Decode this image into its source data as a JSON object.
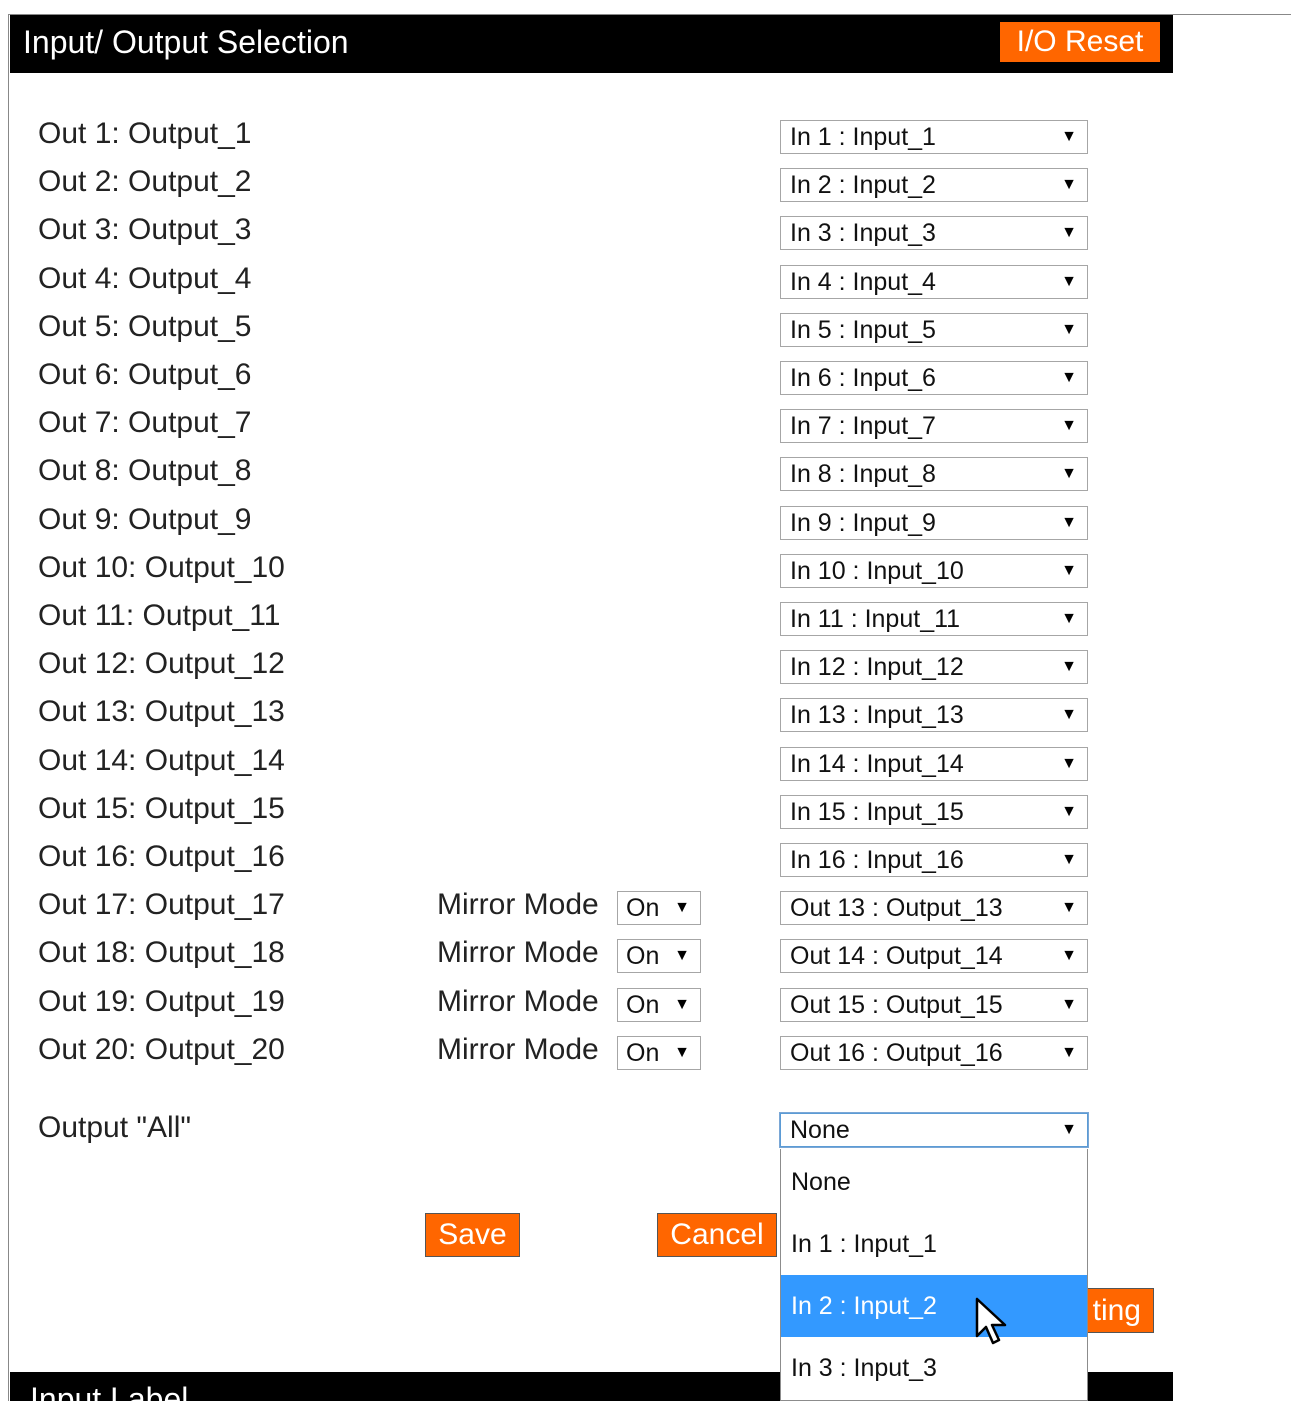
{
  "panel": {
    "title": "Input/ Output Selection",
    "reset_label": "I/O Reset"
  },
  "outputs": [
    {
      "label": "Out 1: Output_1",
      "selection": "In 1 : Input_1"
    },
    {
      "label": "Out 2: Output_2",
      "selection": "In 2 : Input_2"
    },
    {
      "label": "Out 3: Output_3",
      "selection": "In 3 : Input_3"
    },
    {
      "label": "Out 4: Output_4",
      "selection": "In 4 : Input_4"
    },
    {
      "label": "Out 5: Output_5",
      "selection": "In 5 : Input_5"
    },
    {
      "label": "Out 6: Output_6",
      "selection": "In 6 : Input_6"
    },
    {
      "label": "Out 7: Output_7",
      "selection": "In 7 : Input_7"
    },
    {
      "label": "Out 8: Output_8",
      "selection": "In 8 : Input_8"
    },
    {
      "label": "Out 9: Output_9",
      "selection": "In 9 : Input_9"
    },
    {
      "label": "Out 10: Output_10",
      "selection": "In 10 : Input_10"
    },
    {
      "label": "Out 11: Output_11",
      "selection": "In 11 : Input_11"
    },
    {
      "label": "Out 12: Output_12",
      "selection": "In 12 : Input_12"
    },
    {
      "label": "Out 13: Output_13",
      "selection": "In 13 : Input_13"
    },
    {
      "label": "Out 14: Output_14",
      "selection": "In 14 : Input_14"
    },
    {
      "label": "Out 15: Output_15",
      "selection": "In 15 : Input_15"
    },
    {
      "label": "Out 16: Output_16",
      "selection": "In 16 : Input_16"
    },
    {
      "label": "Out 17: Output_17",
      "selection": "Out 13 : Output_13",
      "mirror_label": "Mirror Mode",
      "mirror_value": "On"
    },
    {
      "label": "Out 18: Output_18",
      "selection": "Out 14 : Output_14",
      "mirror_label": "Mirror Mode",
      "mirror_value": "On"
    },
    {
      "label": "Out 19: Output_19",
      "selection": "Out 15 : Output_15",
      "mirror_label": "Mirror Mode",
      "mirror_value": "On"
    },
    {
      "label": "Out 20: Output_20",
      "selection": "Out 16 : Output_16",
      "mirror_label": "Mirror Mode",
      "mirror_value": "On"
    }
  ],
  "output_all": {
    "label": "Output \"All\"",
    "selection": "None",
    "options": [
      "None",
      "In 1 : Input_1",
      "In 2 : Input_2",
      "In 3 : Input_3"
    ],
    "highlighted_option": "In 2 : Input_2"
  },
  "buttons": {
    "save": "Save",
    "cancel": "Cancel",
    "partially_hidden": "ting"
  },
  "next_section": {
    "title": "Input Label"
  },
  "colors": {
    "header_bg": "#000000",
    "accent": "#ff6600",
    "highlight": "#3399ff"
  },
  "icons": {
    "dropdown_arrow": "▼",
    "cursor": "arrow-cursor-icon"
  }
}
